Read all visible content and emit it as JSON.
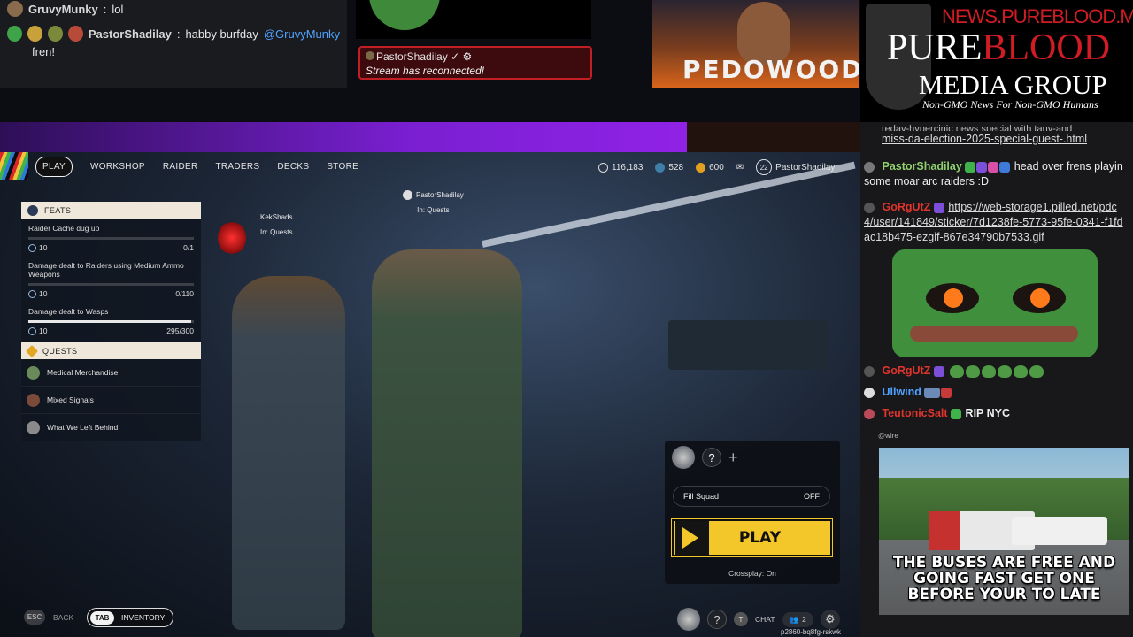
{
  "top_chat": {
    "line1": {
      "name": "GruvyMunky",
      "message": "lol"
    },
    "line2": {
      "name": "PastorShadilay",
      "message": "habby burfday",
      "mention": "@GruvyMunky",
      "continuation": "fren!"
    }
  },
  "stream_notice": {
    "name": "PastorShadilay",
    "message": "Stream has reconnected!"
  },
  "webcam": {
    "overlay_text": "PEDOWOOD"
  },
  "logo": {
    "url": "NEWS.PUREBLOOD.MEDIA",
    "line1_a": "P",
    "line1_b": "URE",
    "line1_c": "BLOOD",
    "line2": "MEDIA GROUP",
    "tagline": "Non-GMO News For Non-GMO Humans"
  },
  "game": {
    "nav": {
      "tabs": [
        {
          "label": "PLAY",
          "active": true
        },
        {
          "label": "WORKSHOP"
        },
        {
          "label": "RAIDER"
        },
        {
          "label": "TRADERS"
        },
        {
          "label": "DECKS"
        },
        {
          "label": "STORE"
        }
      ],
      "stats": {
        "currency1": "116,183",
        "currency2": "528",
        "currency3": "600",
        "level": "22",
        "username": "PastorShadilay"
      }
    },
    "player_tags": [
      {
        "name": "PastorShadilay",
        "status": "In: Quests"
      },
      {
        "name": "KekShads",
        "status": "In: Quests"
      }
    ],
    "feats": {
      "title": "FEATS",
      "items": [
        {
          "label": "Raider Cache dug up",
          "reward": "10",
          "progress": "0/1",
          "fraction": 0
        },
        {
          "label": "Damage dealt to Raiders using Medium Ammo Weapons",
          "reward": "10",
          "progress": "0/110",
          "fraction": 0
        },
        {
          "label": "Damage dealt to Wasps",
          "reward": "10",
          "progress": "295/300",
          "fraction": 0.983
        }
      ]
    },
    "quests": {
      "title": "QUESTS",
      "items": [
        {
          "label": "Medical Merchandise"
        },
        {
          "label": "Mixed Signals"
        },
        {
          "label": "What We Left Behind"
        }
      ]
    },
    "play_panel": {
      "help": "?",
      "add": "+",
      "fill_squad_label": "Fill Squad",
      "fill_squad_value": "OFF",
      "play_label": "PLAY",
      "crossplay": "Crossplay: On"
    },
    "bottom_bar": {
      "back_key": "ESC",
      "back_label": "BACK",
      "inventory_key": "TAB",
      "inventory_label": "INVENTORY",
      "help": "?",
      "chat_key": "T",
      "chat_label": "CHAT",
      "party_count": "2",
      "session_code": "p2860-bq8fg-rskwk"
    }
  },
  "right_chat": {
    "link_tail": "miss-da-election-2025-special-guest-.html",
    "link_tail_prev": "reday-hypercinic news special with tany-and",
    "messages": [
      {
        "name": "PastorShadilay",
        "name_color": "#8fd16b",
        "text": "head over frens playin some moar arc raiders :D"
      },
      {
        "name": "GoRgUtZ",
        "name_color": "#e0342c",
        "link": "https://web-storage1.pilled.net/pdc4/user/141849/sticker/7d1238fe-5773-95fe-0341-f1fdac18b475-ezgif-867e34790b7533.gif"
      },
      {
        "name": "GoRgUtZ",
        "name_color": "#e0342c",
        "text": ""
      },
      {
        "name": "Ullwind",
        "name_color": "#4fa3ff",
        "text": ""
      },
      {
        "name": "TeutonicSalt",
        "name_color": "#e0342c",
        "text": "RIP NYC"
      }
    ],
    "wire_label": "@wire",
    "meme_caption": "THE BUSES ARE FREE AND GOING FAST GET ONE BEFORE YOUR TO LATE"
  }
}
